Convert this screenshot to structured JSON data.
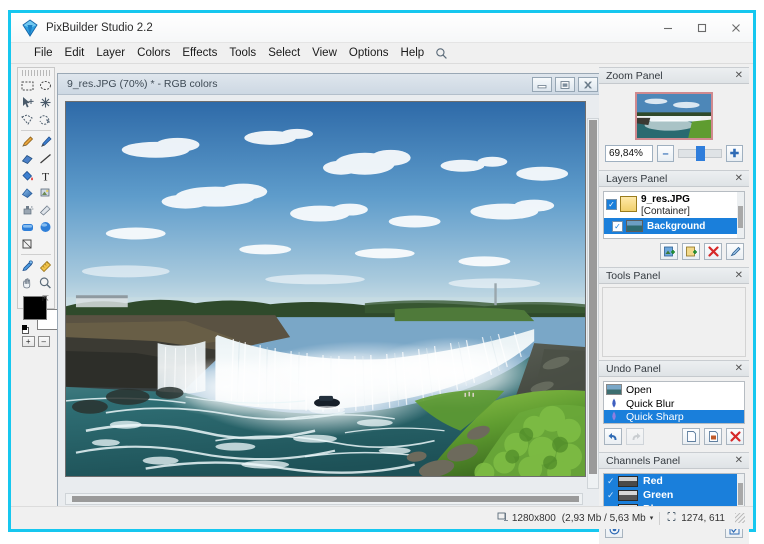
{
  "window": {
    "app_title": "PixBuilder Studio 2.2",
    "app_icon": "diamond-logo-icon",
    "minimize_label": "–",
    "maximize_label": "□",
    "close_label": "✕",
    "accent_border": "#16c7ef"
  },
  "menu": {
    "items": [
      {
        "label": "File"
      },
      {
        "label": "Edit"
      },
      {
        "label": "Layer"
      },
      {
        "label": "Colors"
      },
      {
        "label": "Effects"
      },
      {
        "label": "Tools"
      },
      {
        "label": "Select"
      },
      {
        "label": "View"
      },
      {
        "label": "Options"
      },
      {
        "label": "Help"
      }
    ],
    "search_icon": "magnifier-icon"
  },
  "toolbar": {
    "tools": [
      {
        "name": "rectangle-select-tool"
      },
      {
        "name": "lasso-select-tool"
      },
      {
        "name": "move-tool"
      },
      {
        "name": "magic-wand-tool"
      },
      {
        "name": "polygon-select-tool"
      },
      {
        "name": "free-select-tool"
      },
      {
        "name": "pencil-tool"
      },
      {
        "name": "brush-tool"
      },
      {
        "name": "eraser-tool"
      },
      {
        "name": "line-tool"
      },
      {
        "name": "paint-bucket-tool"
      },
      {
        "name": "text-tool"
      },
      {
        "name": "gradient-tool"
      },
      {
        "name": "clone-stamp-tool"
      },
      {
        "name": "airbrush-tool"
      },
      {
        "name": "smudge-tool"
      },
      {
        "name": "rounded-rect-shape-tool"
      },
      {
        "name": "ellipse-shape-tool"
      },
      {
        "name": "crop-tool"
      },
      {
        "name": "eyedropper-tool"
      },
      {
        "name": "measure-tool"
      },
      {
        "name": "hand-tool"
      },
      {
        "name": "zoom-tool"
      }
    ],
    "foreground_color": "#000000",
    "background_color": "#ffffff",
    "swap_icon": "swap-colors-icon",
    "reset_icon": "reset-colors-icon",
    "plus_label": "+",
    "minus_label": "–"
  },
  "document": {
    "title": "9_res.JPG (70%) * - RGB colors",
    "minimize_icon": "minimize-icon",
    "maximize_icon": "restore-icon",
    "close_icon": "close-icon"
  },
  "zoom_panel": {
    "title": "Zoom Panel",
    "close_label": "✕",
    "value": "69,84%",
    "minus_label": "–",
    "plus_label": "✚",
    "handle_position_pct": 40
  },
  "layers_panel": {
    "title": "Layers Panel",
    "close_label": "✕",
    "rows": [
      {
        "name": "9_res.JPG",
        "sub": "[Container]",
        "selected": false,
        "thumb": "folder-thumb",
        "checked": true
      },
      {
        "name": "Background",
        "sub": "",
        "selected": true,
        "thumb": "image-thumb",
        "checked": true
      }
    ],
    "buttons": [
      {
        "name": "add-layer-button",
        "icon": "new-layer-icon"
      },
      {
        "name": "duplicate-layer-button",
        "icon": "duplicate-layer-icon"
      },
      {
        "name": "delete-layer-button",
        "icon": "delete-red-x-icon"
      },
      {
        "name": "layer-properties-button",
        "icon": "properties-icon"
      }
    ]
  },
  "tools_panel": {
    "title": "Tools Panel",
    "close_label": "✕"
  },
  "undo_panel": {
    "title": "Undo Panel",
    "close_label": "✕",
    "rows": [
      {
        "label": "Open",
        "icon": "image-thumb",
        "selected": false
      },
      {
        "label": "Quick Blur",
        "icon": "blur-drop-icon",
        "selected": false
      },
      {
        "label": "Quick Sharp",
        "icon": "sharp-drop-icon",
        "selected": true
      }
    ],
    "buttons": [
      {
        "name": "undo-button",
        "icon": "undo-arrow-icon",
        "enabled": true
      },
      {
        "name": "redo-button",
        "icon": "redo-arrow-icon",
        "enabled": false
      },
      {
        "name": "new-snapshot-button",
        "icon": "page-icon",
        "enabled": true
      },
      {
        "name": "snapshot-image-button",
        "icon": "page-image-icon",
        "enabled": true
      },
      {
        "name": "clear-history-button",
        "icon": "delete-red-x-icon",
        "enabled": true
      }
    ]
  },
  "channels_panel": {
    "title": "Channels Panel",
    "close_label": "✕",
    "rows": [
      {
        "label": "Red",
        "checked": true,
        "selected": true
      },
      {
        "label": "Green",
        "checked": true,
        "selected": true
      },
      {
        "label": "Blue",
        "checked": true,
        "selected": true
      }
    ],
    "buttons": [
      {
        "name": "channel-view-button",
        "icon": "channel-eye-icon"
      },
      {
        "name": "channel-select-button",
        "icon": "channel-check-icon"
      }
    ]
  },
  "status_bar": {
    "dimensions_icon": "image-size-icon",
    "dimensions": "1280x800",
    "memory": "(2,93 Mb / 5,63 Mb",
    "dropdown_caret": "▾",
    "cursor_icon": "cursor-position-icon",
    "cursor_position": "1274, 611"
  }
}
